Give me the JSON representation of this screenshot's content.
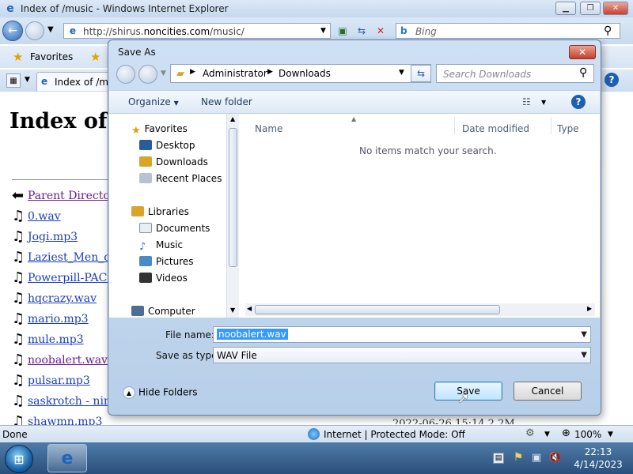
{
  "ie": {
    "title": "Index of /music - Windows Internet Explorer",
    "url_prefix": "http://shirus.",
    "url_domain": "noncities.com",
    "url_suffix": "/music/",
    "search_placeholder": "Bing",
    "favorites_label": "Favorites",
    "tab_label": "Index of /mus",
    "page_heading": "Index of /",
    "status_text": "Done",
    "zone_text": "Internet | Protected Mode: Off",
    "zoom": "100%",
    "partial_date": "2022-06-26 15:14  2.2M"
  },
  "listing": [
    {
      "name": "Parent Directory",
      "icon": "back-arrow-icon",
      "visited": true
    },
    {
      "name": "0.wav",
      "icon": "music-note-icon",
      "visited": false
    },
    {
      "name": "Jogi.mp3",
      "icon": "music-note-icon",
      "visited": false
    },
    {
      "name": "Laziest_Men_on",
      "icon": "music-note-icon",
      "visited": false
    },
    {
      "name": "Powerpill-PAC-",
      "icon": "music-note-icon",
      "visited": false
    },
    {
      "name": "hqcrazy.wav",
      "icon": "music-note-icon",
      "visited": false
    },
    {
      "name": "mario.mp3",
      "icon": "music-note-icon",
      "visited": false
    },
    {
      "name": "mule.mp3",
      "icon": "music-note-icon",
      "visited": false
    },
    {
      "name": "noobalert.wav",
      "icon": "music-note-icon",
      "visited": true
    },
    {
      "name": "pulsar.mp3",
      "icon": "music-note-icon",
      "visited": false
    },
    {
      "name": "saskrotch - ninte",
      "icon": "music-note-icon",
      "visited": false
    },
    {
      "name": "shawmn.mp3",
      "icon": "music-note-icon",
      "visited": false
    }
  ],
  "dialog": {
    "title": "Save As",
    "breadcrumb": [
      "Administrator",
      "Downloads"
    ],
    "search_placeholder": "Search Downloads",
    "organize": "Organize",
    "new_folder": "New folder",
    "nav": {
      "favorites": "Favorites",
      "desktop": "Desktop",
      "downloads": "Downloads",
      "recent": "Recent Places",
      "libraries": "Libraries",
      "documents": "Documents",
      "music": "Music",
      "pictures": "Pictures",
      "videos": "Videos",
      "computer": "Computer"
    },
    "columns": {
      "name": "Name",
      "date": "Date modified",
      "type": "Type"
    },
    "empty_message": "No items match your search.",
    "file_name_label": "File name:",
    "file_name": "noobalert.wav",
    "save_type_label": "Save as type:",
    "save_type": "WAV File",
    "hide_folders": "Hide Folders",
    "save": "Save",
    "cancel": "Cancel"
  },
  "taskbar": {
    "time": "22:13",
    "date": "4/14/2023"
  }
}
